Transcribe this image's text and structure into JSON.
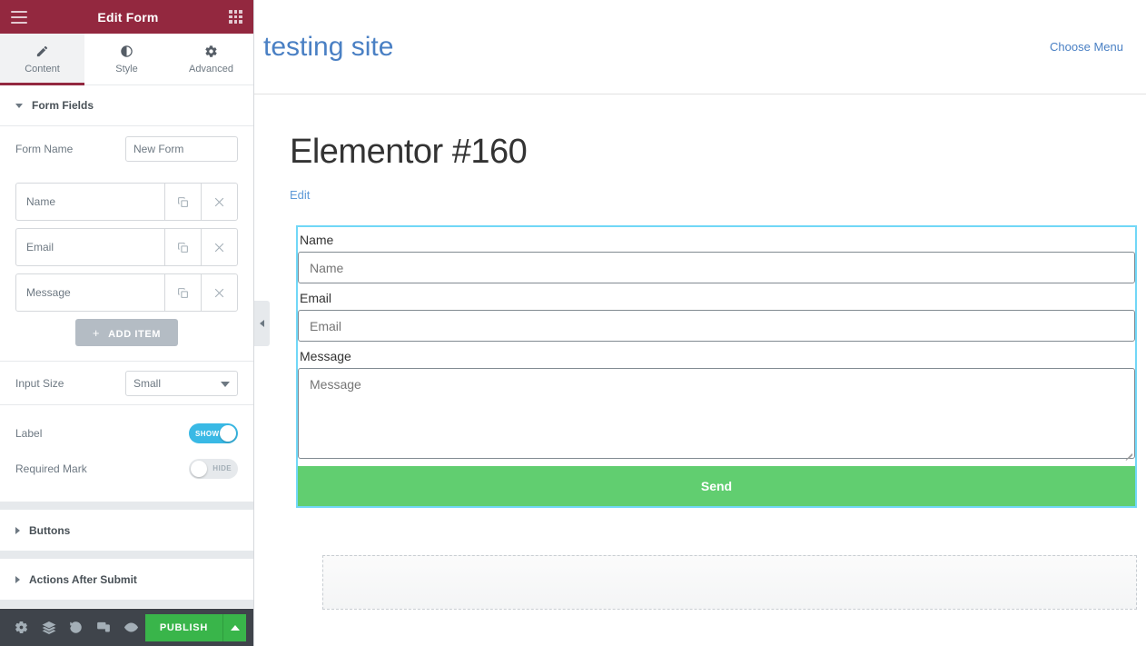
{
  "panel": {
    "header": {
      "title": "Edit Form",
      "menu_icon": "hamburger-icon",
      "apps_icon": "grid-icon"
    },
    "tabs": [
      {
        "label": "Content",
        "icon": "pencil-icon",
        "active": true
      },
      {
        "label": "Style",
        "icon": "contrast-circle-icon",
        "active": false
      },
      {
        "label": "Advanced",
        "icon": "gear-icon",
        "active": false
      }
    ],
    "sections": {
      "form_fields": {
        "title": "Form Fields",
        "expanded": true,
        "form_name_label": "Form Name",
        "form_name_value": "New Form",
        "fields": [
          {
            "label": "Name",
            "duplicate_icon": "copy-icon",
            "remove_icon": "close-icon"
          },
          {
            "label": "Email",
            "duplicate_icon": "copy-icon",
            "remove_icon": "close-icon"
          },
          {
            "label": "Message",
            "duplicate_icon": "copy-icon",
            "remove_icon": "close-icon"
          }
        ],
        "add_item_label": "ADD ITEM",
        "add_item_plus": "+",
        "input_size_label": "Input Size",
        "input_size_value": "Small",
        "label_toggle_label": "Label",
        "label_toggle_state": "SHOW",
        "required_mark_label": "Required Mark",
        "required_mark_state": "HIDE"
      },
      "buttons": {
        "title": "Buttons",
        "expanded": false
      },
      "actions_after_submit": {
        "title": "Actions After Submit",
        "expanded": false
      }
    },
    "footer": {
      "icons": [
        "settings-gear-icon",
        "navigator-layers-icon",
        "history-icon",
        "responsive-mode-icon",
        "preview-eye-icon"
      ],
      "publish_label": "PUBLISH",
      "publish_dropdown_icon": "caret-up-icon"
    }
  },
  "collapse_handle": {
    "icon": "chevron-left-icon"
  },
  "preview": {
    "site_title": "testing site",
    "choose_menu": "Choose Menu",
    "page_title": "Elementor #160",
    "edit_link": "Edit",
    "form": {
      "fields": [
        {
          "label": "Name",
          "placeholder": "Name",
          "type": "text"
        },
        {
          "label": "Email",
          "placeholder": "Email",
          "type": "text"
        },
        {
          "label": "Message",
          "placeholder": "Message",
          "type": "textarea"
        }
      ],
      "submit_label": "Send"
    }
  },
  "colors": {
    "panel_header": "#93283f",
    "accent_cyan": "#39b9e5",
    "selection_border": "#71d7f7",
    "send_button": "#61ce70",
    "publish_button": "#39b54a",
    "site_link": "#4a80c4"
  }
}
